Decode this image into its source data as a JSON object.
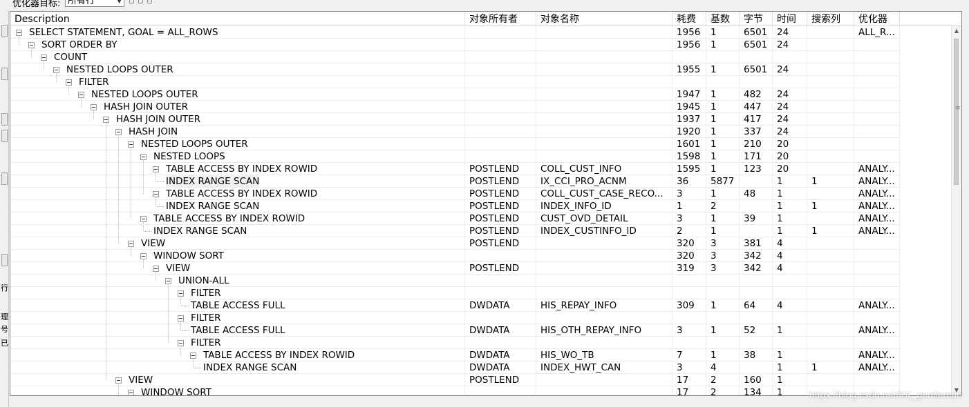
{
  "toolbar": {
    "label": "优化器目标:",
    "combo_value": "所有行",
    "extra_text": "▫ ▫ ▫"
  },
  "gutter_chars": [
    "行",
    "理",
    "号",
    "已"
  ],
  "columns": [
    {
      "key": "desc",
      "label": "Description"
    },
    {
      "key": "owner",
      "label": "对象所有者"
    },
    {
      "key": "name",
      "label": "对象名称"
    },
    {
      "key": "cost",
      "label": "耗费"
    },
    {
      "key": "card",
      "label": "基数"
    },
    {
      "key": "bytes",
      "label": "字节"
    },
    {
      "key": "time",
      "label": "时间"
    },
    {
      "key": "search",
      "label": "搜索列"
    },
    {
      "key": "optimizer",
      "label": "优化器"
    }
  ],
  "rows": [
    {
      "level": 0,
      "expandable": true,
      "desc": "SELECT STATEMENT, GOAL = ALL_ROWS",
      "owner": "",
      "name": "",
      "cost": "1956",
      "card": "1",
      "bytes": "6501",
      "time": "24",
      "search": "",
      "optimizer": "ALL_R..."
    },
    {
      "level": 1,
      "expandable": true,
      "desc": "SORT ORDER BY",
      "owner": "",
      "name": "",
      "cost": "1956",
      "card": "1",
      "bytes": "6501",
      "time": "24",
      "search": "",
      "optimizer": ""
    },
    {
      "level": 2,
      "expandable": true,
      "desc": "COUNT",
      "owner": "",
      "name": "",
      "cost": "",
      "card": "",
      "bytes": "",
      "time": "",
      "search": "",
      "optimizer": ""
    },
    {
      "level": 3,
      "expandable": true,
      "desc": "NESTED LOOPS OUTER",
      "owner": "",
      "name": "",
      "cost": "1955",
      "card": "1",
      "bytes": "6501",
      "time": "24",
      "search": "",
      "optimizer": ""
    },
    {
      "level": 4,
      "expandable": true,
      "desc": "FILTER",
      "owner": "",
      "name": "",
      "cost": "",
      "card": "",
      "bytes": "",
      "time": "",
      "search": "",
      "optimizer": ""
    },
    {
      "level": 5,
      "expandable": true,
      "desc": "NESTED LOOPS OUTER",
      "owner": "",
      "name": "",
      "cost": "1947",
      "card": "1",
      "bytes": "482",
      "time": "24",
      "search": "",
      "optimizer": ""
    },
    {
      "level": 6,
      "expandable": true,
      "desc": "HASH JOIN OUTER",
      "owner": "",
      "name": "",
      "cost": "1945",
      "card": "1",
      "bytes": "447",
      "time": "24",
      "search": "",
      "optimizer": ""
    },
    {
      "level": 7,
      "expandable": true,
      "desc": "HASH JOIN OUTER",
      "owner": "",
      "name": "",
      "cost": "1937",
      "card": "1",
      "bytes": "417",
      "time": "24",
      "search": "",
      "optimizer": ""
    },
    {
      "level": 8,
      "expandable": true,
      "desc": "HASH JOIN",
      "owner": "",
      "name": "",
      "cost": "1920",
      "card": "1",
      "bytes": "337",
      "time": "24",
      "search": "",
      "optimizer": ""
    },
    {
      "level": 9,
      "expandable": true,
      "desc": "NESTED LOOPS OUTER",
      "owner": "",
      "name": "",
      "cost": "1601",
      "card": "1",
      "bytes": "210",
      "time": "20",
      "search": "",
      "optimizer": ""
    },
    {
      "level": 10,
      "expandable": true,
      "desc": "NESTED LOOPS",
      "owner": "",
      "name": "",
      "cost": "1598",
      "card": "1",
      "bytes": "171",
      "time": "20",
      "search": "",
      "optimizer": ""
    },
    {
      "level": 11,
      "expandable": true,
      "desc": "TABLE ACCESS BY INDEX ROWID",
      "owner": "POSTLEND",
      "name": "COLL_CUST_INFO",
      "cost": "1595",
      "card": "1",
      "bytes": "123",
      "time": "20",
      "search": "",
      "optimizer": "ANALY..."
    },
    {
      "level": 12,
      "expandable": false,
      "selected": true,
      "desc": "INDEX RANGE SCAN",
      "owner": "POSTLEND",
      "name": "IX_CCI_PRO_ACNM",
      "cost": "36",
      "card": "5877",
      "bytes": "",
      "time": "1",
      "search": "1",
      "optimizer": "ANALY..."
    },
    {
      "level": 11,
      "expandable": true,
      "desc": "TABLE ACCESS BY INDEX ROWID",
      "owner": "POSTLEND",
      "name": "COLL_CUST_CASE_RECO...",
      "cost": "3",
      "card": "1",
      "bytes": "48",
      "time": "1",
      "search": "",
      "optimizer": "ANALY..."
    },
    {
      "level": 12,
      "expandable": false,
      "desc": "INDEX RANGE SCAN",
      "owner": "POSTLEND",
      "name": "INDEX_INFO_ID",
      "cost": "1",
      "card": "2",
      "bytes": "",
      "time": "1",
      "search": "1",
      "optimizer": "ANALY..."
    },
    {
      "level": 10,
      "expandable": true,
      "desc": "TABLE ACCESS BY INDEX ROWID",
      "owner": "POSTLEND",
      "name": "CUST_OVD_DETAIL",
      "cost": "3",
      "card": "1",
      "bytes": "39",
      "time": "1",
      "search": "",
      "optimizer": "ANALY..."
    },
    {
      "level": 11,
      "expandable": false,
      "desc": "INDEX RANGE SCAN",
      "owner": "POSTLEND",
      "name": "INDEX_CUSTINFO_ID",
      "cost": "2",
      "card": "1",
      "bytes": "",
      "time": "1",
      "search": "1",
      "optimizer": "ANALY..."
    },
    {
      "level": 9,
      "expandable": true,
      "desc": "VIEW",
      "owner": "POSTLEND",
      "name": "",
      "cost": "320",
      "card": "3",
      "bytes": "381",
      "time": "4",
      "search": "",
      "optimizer": ""
    },
    {
      "level": 10,
      "expandable": true,
      "desc": "WINDOW SORT",
      "owner": "",
      "name": "",
      "cost": "320",
      "card": "3",
      "bytes": "342",
      "time": "4",
      "search": "",
      "optimizer": ""
    },
    {
      "level": 11,
      "expandable": true,
      "desc": "VIEW",
      "owner": "POSTLEND",
      "name": "",
      "cost": "319",
      "card": "3",
      "bytes": "342",
      "time": "4",
      "search": "",
      "optimizer": ""
    },
    {
      "level": 12,
      "expandable": true,
      "desc": "UNION-ALL",
      "owner": "",
      "name": "",
      "cost": "",
      "card": "",
      "bytes": "",
      "time": "",
      "search": "",
      "optimizer": ""
    },
    {
      "level": 13,
      "expandable": true,
      "desc": "FILTER",
      "owner": "",
      "name": "",
      "cost": "",
      "card": "",
      "bytes": "",
      "time": "",
      "search": "",
      "optimizer": ""
    },
    {
      "level": 14,
      "expandable": false,
      "desc": "TABLE ACCESS FULL",
      "owner": "DWDATA",
      "name": "HIS_REPAY_INFO",
      "cost": "309",
      "card": "1",
      "bytes": "64",
      "time": "4",
      "search": "",
      "optimizer": "ANALY..."
    },
    {
      "level": 13,
      "expandable": true,
      "desc": "FILTER",
      "owner": "",
      "name": "",
      "cost": "",
      "card": "",
      "bytes": "",
      "time": "",
      "search": "",
      "optimizer": ""
    },
    {
      "level": 14,
      "expandable": false,
      "desc": "TABLE ACCESS FULL",
      "owner": "DWDATA",
      "name": "HIS_OTH_REPAY_INFO",
      "cost": "3",
      "card": "1",
      "bytes": "52",
      "time": "1",
      "search": "",
      "optimizer": "ANALY..."
    },
    {
      "level": 13,
      "expandable": true,
      "desc": "FILTER",
      "owner": "",
      "name": "",
      "cost": "",
      "card": "",
      "bytes": "",
      "time": "",
      "search": "",
      "optimizer": ""
    },
    {
      "level": 14,
      "expandable": true,
      "desc": "TABLE ACCESS BY INDEX ROWID",
      "owner": "DWDATA",
      "name": "HIS_WO_TB",
      "cost": "7",
      "card": "1",
      "bytes": "38",
      "time": "1",
      "search": "",
      "optimizer": "ANALY..."
    },
    {
      "level": 15,
      "expandable": false,
      "desc": "INDEX RANGE SCAN",
      "owner": "DWDATA",
      "name": "INDEX_HWT_CAN",
      "cost": "3",
      "card": "4",
      "bytes": "",
      "time": "1",
      "search": "1",
      "optimizer": "ANALY..."
    },
    {
      "level": 8,
      "expandable": true,
      "desc": "VIEW",
      "owner": "POSTLEND",
      "name": "",
      "cost": "17",
      "card": "2",
      "bytes": "160",
      "time": "1",
      "search": "",
      "optimizer": ""
    },
    {
      "level": 9,
      "expandable": true,
      "desc": "WINDOW SORT",
      "owner": "",
      "name": "",
      "cost": "17",
      "card": "2",
      "bytes": "134",
      "time": "1",
      "search": "",
      "optimizer": ""
    }
  ],
  "watermark": "https://blog.csdn.net/KK_gentleman"
}
